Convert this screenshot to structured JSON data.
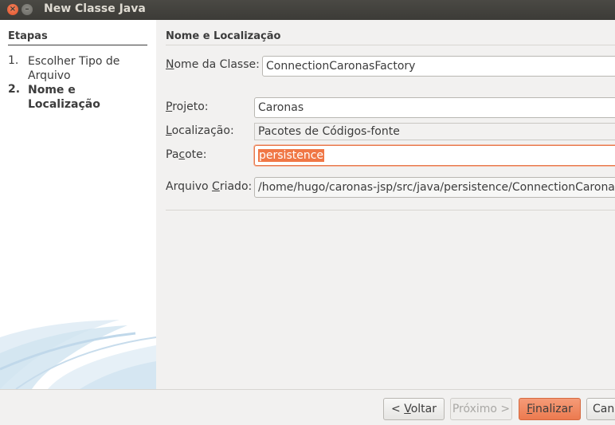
{
  "window": {
    "title": "New Classe Java"
  },
  "sidebar": {
    "heading": "Etapas",
    "steps": [
      {
        "num": "1.",
        "label": "Escolher Tipo de Arquivo"
      },
      {
        "num": "2.",
        "label": "Nome e Localização"
      }
    ]
  },
  "main": {
    "section_title": "Nome e Localização",
    "class_name": {
      "label_prefix": "",
      "label_mnemonic": "N",
      "label_rest": "ome da Classe:",
      "value": "ConnectionCaronasFactory"
    },
    "project": {
      "label_mnemonic": "P",
      "label_rest": "rojeto:",
      "value": "Caronas"
    },
    "location": {
      "label_mnemonic": "L",
      "label_rest": "ocalização:",
      "value": "Pacotes de Códigos-fonte"
    },
    "package": {
      "label_prefix": "Pa",
      "label_mnemonic": "c",
      "label_rest": "ote:",
      "value": "persistence"
    },
    "created_file": {
      "label_prefix": "Arquivo ",
      "label_mnemonic": "C",
      "label_rest": "riado:",
      "value": "/home/hugo/caronas-jsp/src/java/persistence/ConnectionCaronasFactory.java"
    }
  },
  "footer": {
    "back": {
      "prefix": "< ",
      "mnemonic": "V",
      "rest": "oltar"
    },
    "next": {
      "label": "Próximo >"
    },
    "finish": {
      "mnemonic": "F",
      "rest": "inalizar"
    },
    "cancel": {
      "label": "Cancelar"
    }
  },
  "colors": {
    "accent": "#f07746",
    "titlebar": "#3c3b37"
  }
}
